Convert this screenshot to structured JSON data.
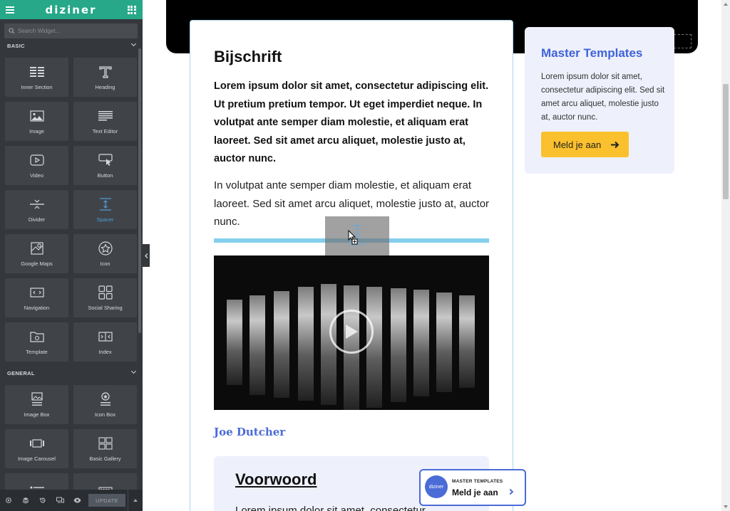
{
  "sidebar": {
    "logo": "diziner",
    "search_placeholder": "Search Widget...",
    "sections": [
      {
        "title": "BASIC",
        "widgets": [
          {
            "label": "Inner Section",
            "icon": "inner-section-icon"
          },
          {
            "label": "Heading",
            "icon": "heading-icon"
          },
          {
            "label": "Image",
            "icon": "image-icon"
          },
          {
            "label": "Text Editor",
            "icon": "text-editor-icon"
          },
          {
            "label": "Video",
            "icon": "video-icon"
          },
          {
            "label": "Button",
            "icon": "button-icon"
          },
          {
            "label": "Divider",
            "icon": "divider-icon"
          },
          {
            "label": "Spacer",
            "icon": "spacer-icon",
            "active": true
          },
          {
            "label": "Google Maps",
            "icon": "map-icon"
          },
          {
            "label": "Icon",
            "icon": "star-icon"
          },
          {
            "label": "Navigation",
            "icon": "navigation-icon"
          },
          {
            "label": "Social Sharing",
            "icon": "social-sharing-icon"
          },
          {
            "label": "Template",
            "icon": "template-icon"
          },
          {
            "label": "Index",
            "icon": "index-icon"
          }
        ]
      },
      {
        "title": "GENERAL",
        "widgets": [
          {
            "label": "Image Box",
            "icon": "image-box-icon"
          },
          {
            "label": "Icon Box",
            "icon": "icon-box-icon"
          },
          {
            "label": "Image Carousel",
            "icon": "carousel-icon"
          },
          {
            "label": "Basic Gallery",
            "icon": "gallery-icon"
          }
        ]
      }
    ],
    "footer": {
      "update_label": "UPDATE"
    },
    "drag_ghost_label": "Spacer"
  },
  "main": {
    "caption_title": "Bijschrift",
    "bold_paragraph": "Lorem ipsum dolor sit amet, consectetur adipiscing elit. Ut pretium pretium tempor. Ut eget imperdiet neque. In volutpat ante semper diam molestie, et aliquam erat laoreet. Sed sit amet arcu aliquet, molestie justo at, auctor nunc.",
    "normal_paragraph": "In volutpat ante semper diam molestie, et aliquam erat laoreet. Sed sit amet arcu aliquet, molestie justo at, auctor nunc.",
    "author": "Joe Dutcher",
    "foreword_title": "Voorwoord",
    "foreword_text": "Lorem ipsum dolor sit amet, consectetur"
  },
  "side_card": {
    "title": "Master Templates",
    "text": "Lorem ipsum dolor sit amet, consectetur adipiscing elit. Sed sit amet arcu aliquet, molestie justo at, auctor nunc.",
    "button_label": "Meld je aan"
  },
  "floating_cta": {
    "logo_text": "diziner",
    "small_label": "MASTER TEMPLATES",
    "big_label": "Meld je aan"
  },
  "colors": {
    "brand_green": "#26a889",
    "accent_blue": "#3f63d8",
    "cta_yellow": "#fbc02d",
    "drop_indicator": "#84cfee"
  }
}
